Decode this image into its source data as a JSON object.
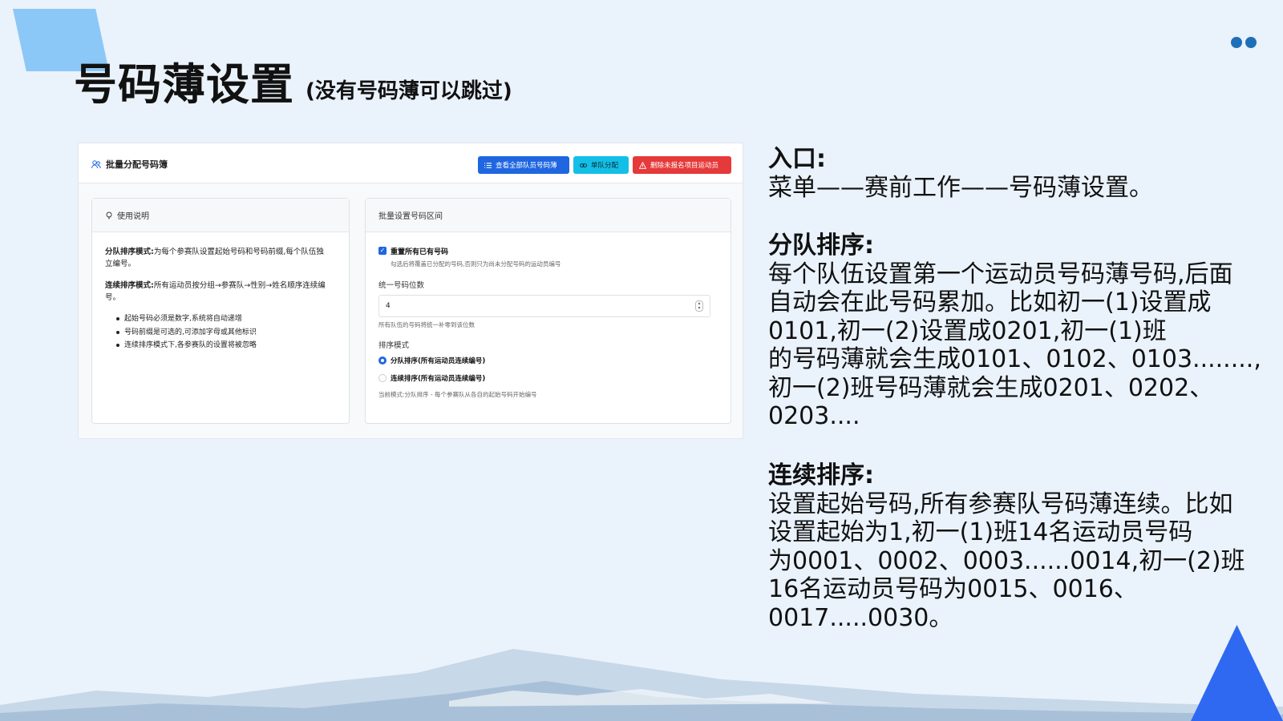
{
  "slide": {
    "title": "号码薄设置",
    "subtitle": "(没有号码薄可以跳过)",
    "colors": {
      "accent": "#2f69f2",
      "light_accent": "#8cc8f7",
      "dots": "#1f6fb8"
    }
  },
  "panel": {
    "header_title": "批量分配号码簿",
    "header_icon": "users-icon",
    "buttons": {
      "view_all": {
        "label": "查看全部队员号码薄",
        "icon": "list-icon",
        "color": "#1f66e0"
      },
      "single": {
        "label": "单队分配",
        "icon": "link-icon",
        "color": "#13bfe6"
      },
      "delete": {
        "label": "删除未报名项目运动员",
        "icon": "warning-icon",
        "color": "#e5393a"
      }
    },
    "instructions": {
      "title": "使用说明",
      "icon": "lightbulb-icon",
      "team_mode_label": "分队排序模式:",
      "team_mode_text_1": "为每个参赛队设置起始号码和号码前缀,每个队伍独",
      "team_mode_text_2": "立编号。",
      "continuous_mode_label": "连续排序模式:",
      "continuous_mode_text_1": "所有运动员按分组→参赛队→性别→姓名顺序连续编",
      "continuous_mode_text_2": "号。",
      "bullets": [
        "起始号码必须是数字,系统将自动递增",
        "号码前缀是可选的,可添加字母或其他标识",
        "连续排序模式下,各参赛队的设置将被忽略"
      ]
    },
    "batch": {
      "title": "批量设置号码区间",
      "reset_label": "重置所有已有号码",
      "reset_checked": true,
      "reset_note": "勾选后将覆盖已分配的号码,否则只为尚未分配号码的运动员编号",
      "digits_label": "统一号码位数",
      "digits_value": "4",
      "digits_note": "所有队伍的号码将统一补零到该位数",
      "sort_label": "排序模式",
      "sort_options": [
        {
          "label": "分队排序(所有运动员连续编号)",
          "selected": true
        },
        {
          "label": "连续排序(所有运动员连续编号)",
          "selected": false
        }
      ],
      "current_mode": "当前模式:分队排序 - 每个参赛队从各自的起始号码开始编号"
    }
  },
  "notes": {
    "entry_heading": "入口:",
    "entry_text": "菜单——赛前工作——号码薄设置。",
    "team_heading": "分队排序:",
    "team_lines": [
      "每个队伍设置第一个运动员号码薄号码,后面",
      "自动会在此号码累加。比如初一(1)设置成",
      "0101,初一(2)设置成0201,初一(1)班",
      "的号码薄就会生成0101、0102、0103........,",
      "初一(2)班号码薄就会生成0201、0202、",
      "0203...."
    ],
    "continuous_heading": "连续排序:",
    "continuous_lines": [
      "设置起始号码,所有参赛队号码薄连续。比如",
      "设置起始为1,初一(1)班14名运动员号码",
      "为0001、0002、0003......0014,初一(2)班",
      "16名运动员号码为0015、0016、",
      "0017.....0030。"
    ]
  }
}
